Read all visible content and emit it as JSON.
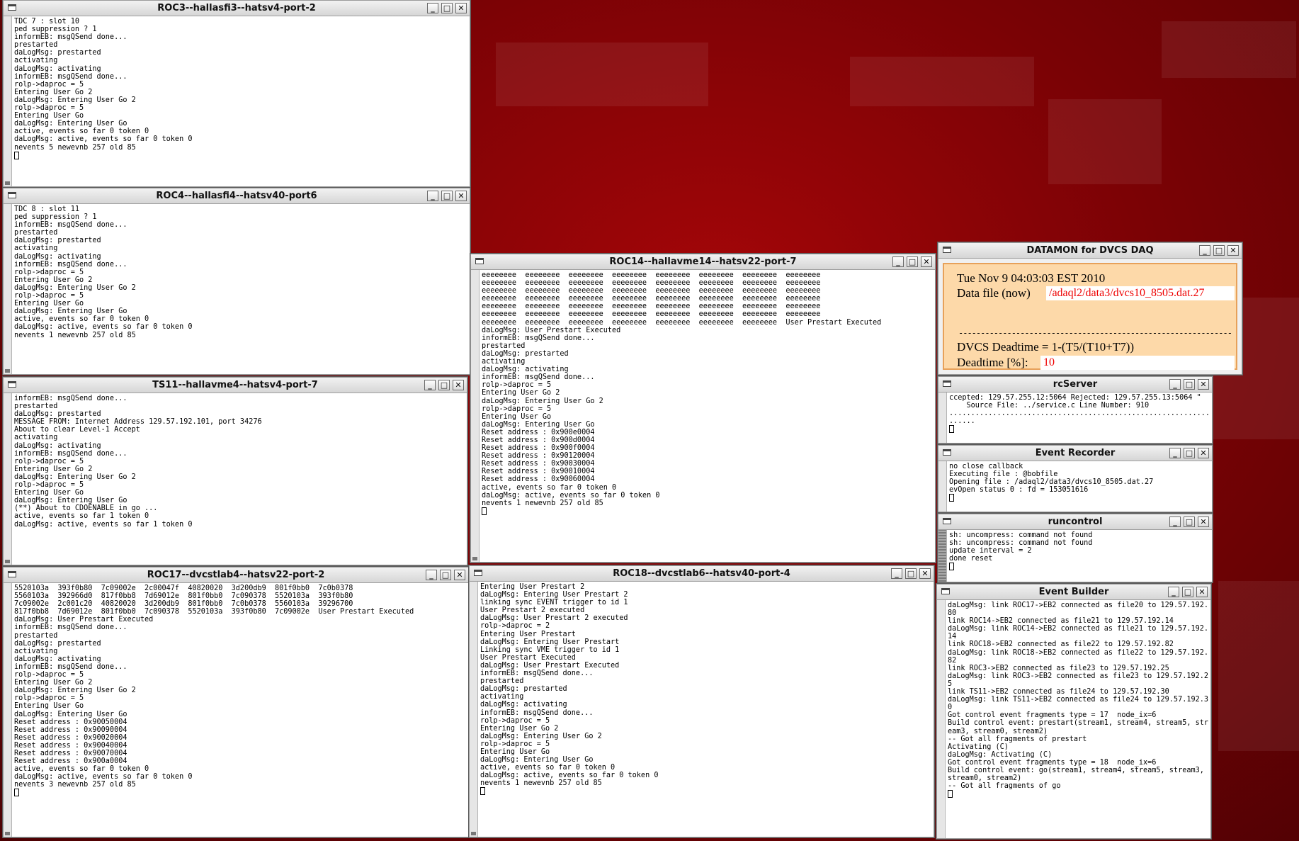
{
  "windows": {
    "roc3": {
      "title": "ROC3--hallasfi3--hatsv4-port-2",
      "log": "TDC 7 : slot 10\nped suppression ? 1\ninformEB: msgQSend done...\nprestarted\ndaLogMsg: prestarted\nactivating\ndaLogMsg: activating\ninformEB: msgQSend done...\nrolp->daproc = 5\nEntering User Go 2\ndaLogMsg: Entering User Go 2\nrolp->daproc = 5\nEntering User Go\ndaLogMsg: Entering User Go\nactive, events so far 0 token 0\ndaLogMsg: active, events so far 0 token 0\nnevents 5 newevnb 257 old 85"
    },
    "roc4": {
      "title": "ROC4--hallasfi4--hatsv40-port6",
      "log": "TDC 8 : slot 11\nped suppression ? 1\ninformEB: msgQSend done...\nprestarted\ndaLogMsg: prestarted\nactivating\ndaLogMsg: activating\ninformEB: msgQSend done...\nrolp->daproc = 5\nEntering User Go 2\ndaLogMsg: Entering User Go 2\nrolp->daproc = 5\nEntering User Go\ndaLogMsg: Entering User Go\nactive, events so far 0 token 0\ndaLogMsg: active, events so far 0 token 0\nnevents 1 newevnb 257 old 85"
    },
    "ts11": {
      "title": "TS11--hallavme4--hatsv4-port-7",
      "log": "informEB: msgQSend done...\nprestarted\ndaLogMsg: prestarted\nMESSAGE FROM: Internet Address 129.57.192.101, port 34276\nAbout to clear Level-1 Accept\nactivating\ndaLogMsg: activating\ninformEB: msgQSend done...\nrolp->daproc = 5\nEntering User Go 2\ndaLogMsg: Entering User Go 2\nrolp->daproc = 5\nEntering User Go\ndaLogMsg: Entering User Go\n(**) About to CDOENABLE in go ...\nactive, events so far 1 token 0\ndaLogMsg: active, events so far 1 token 0"
    },
    "roc17": {
      "title": "ROC17--dvcstlab4--hatsv22-port-2",
      "log": "5520103a  393f0b80  7c09002e  2c00047f  40820020  3d200db9  801f0bb0  7c0b0378\n5560103a  392966d0  817f0bb8  7d69012e  801f0bb0  7c090378  5520103a  393f0b80\n7c09002e  2c001c20  40820020  3d200db9  801f0bb0  7c0b0378  5560103a  39296700\n817f0bb8  7d69012e  801f0bb0  7c090378  5520103a  393f0b80  7c09002e  User Prestart Executed\ndaLogMsg: User Prestart Executed\ninformEB: msgQSend done...\nprestarted\ndaLogMsg: prestarted\nactivating\ndaLogMsg: activating\ninformEB: msgQSend done...\nrolp->daproc = 5\nEntering User Go 2\ndaLogMsg: Entering User Go 2\nrolp->daproc = 5\nEntering User Go\ndaLogMsg: Entering User Go\nReset address : 0x90050004\nReset address : 0x90090004\nReset address : 0x90020004\nReset address : 0x90040004\nReset address : 0x90070004\nReset address : 0x900a0004\nactive, events so far 0 token 0\ndaLogMsg: active, events so far 0 token 0\nnevents 3 newevnb 257 old 85"
    },
    "roc14": {
      "title": "ROC14--hallavme14--hatsv22-port-7",
      "log": "eeeeeeee  eeeeeeee  eeeeeeee  eeeeeeee  eeeeeeee  eeeeeeee  eeeeeeee  eeeeeeee\neeeeeeee  eeeeeeee  eeeeeeee  eeeeeeee  eeeeeeee  eeeeeeee  eeeeeeee  eeeeeeee\neeeeeeee  eeeeeeee  eeeeeeee  eeeeeeee  eeeeeeee  eeeeeeee  eeeeeeee  eeeeeeee\neeeeeeee  eeeeeeee  eeeeeeee  eeeeeeee  eeeeeeee  eeeeeeee  eeeeeeee  eeeeeeee\neeeeeeee  eeeeeeee  eeeeeeee  eeeeeeee  eeeeeeee  eeeeeeee  eeeeeeee  eeeeeeee\neeeeeeee  eeeeeeee  eeeeeeee  eeeeeeee  eeeeeeee  eeeeeeee  eeeeeeee  eeeeeeee\neeeeeeee  eeeeeeee  eeeeeeee  eeeeeeee  eeeeeeee  eeeeeeee  eeeeeeee  User Prestart Executed\ndaLogMsg: User Prestart Executed\ninformEB: msgQSend done...\nprestarted\ndaLogMsg: prestarted\nactivating\ndaLogMsg: activating\ninformEB: msgQSend done...\nrolp->daproc = 5\nEntering User Go 2\ndaLogMsg: Entering User Go 2\nrolp->daproc = 5\nEntering User Go\ndaLogMsg: Entering User Go\nReset address : 0x900e0004\nReset address : 0x900d0004\nReset address : 0x900f0004\nReset address : 0x90120004\nReset address : 0x90030004\nReset address : 0x90010004\nReset address : 0x90060004\nactive, events so far 0 token 0\ndaLogMsg: active, events so far 0 token 0\nnevents 1 newevnb 257 old 85"
    },
    "roc18": {
      "title": "ROC18--dvcstlab6--hatsv40-port-4",
      "log": "Entering User Prestart 2\ndaLogMsg: Entering User Prestart 2\nlinking sync EVENT trigger to id 1\nUser Prestart 2 executed\ndaLogMsg: User Prestart 2 executed\nrolp->daproc = 2\nEntering User Prestart\ndaLogMsg: Entering User Prestart\nLinking sync VME trigger to id 1\nUser Prestart Executed\ndaLogMsg: User Prestart Executed\ninformEB: msgQSend done...\nprestarted\ndaLogMsg: prestarted\nactivating\ndaLogMsg: activating\ninformEB: msgQSend done...\nrolp->daproc = 5\nEntering User Go 2\ndaLogMsg: Entering User Go 2\nrolp->daproc = 5\nEntering User Go\ndaLogMsg: Entering User Go\nactive, events so far 0 token 0\ndaLogMsg: active, events so far 0 token 0\nnevents 1 newevnb 257 old 85"
    },
    "datamon": {
      "title": "DATAMON  for DVCS DAQ",
      "datetime": "Tue Nov  9 04:03:03 EST 2010",
      "datafile_label": "Data file (now)",
      "datafile_value": "/adaql2/data3/dvcs10_8505.dat.27",
      "dashes": "--------------------------------------------------------------------------------",
      "deadtime_formula": "DVCS Deadtime = 1-(T5/(T10+T7))",
      "deadtime_label": "Deadtime [%]:",
      "deadtime_value": "10"
    },
    "rcserver": {
      "title": "rcServer",
      "log": "ccepted: 129.57.255.12:5064 Rejected: 129.57.255.13:5064 \"\n    Source File: ../service.c Line Number: 910\n......................................................................\n......"
    },
    "eventrecorder": {
      "title": "Event Recorder",
      "log": "no close callback\nExecuting file : @bobfile\nOpening file : /adaql2/data3/dvcs10_8505.dat.27\nevOpen status 0 : fd = 153051616"
    },
    "runcontrol": {
      "title": "runcontrol",
      "log": "sh: uncompress: command not found\nsh: uncompress: command not found\nupdate interval = 2\ndone reset"
    },
    "eventbuilder": {
      "title": "Event Builder",
      "log": "daLogMsg: link ROC17->EB2 connected as file20 to 129.57.192.\n80\nlink ROC14->EB2 connected as file21 to 129.57.192.14\ndaLogMsg: link ROC14->EB2 connected as file21 to 129.57.192.\n14\nlink ROC18->EB2 connected as file22 to 129.57.192.82\ndaLogMsg: link ROC18->EB2 connected as file22 to 129.57.192.\n82\nlink ROC3->EB2 connected as file23 to 129.57.192.25\ndaLogMsg: link ROC3->EB2 connected as file23 to 129.57.192.2\n5\nlink TS11->EB2 connected as file24 to 129.57.192.30\ndaLogMsg: link TS11->EB2 connected as file24 to 129.57.192.3\n0\nGot control event fragments type = 17  node_ix=6\nBuild control event: prestart(stream1, stream4, stream5, str\neam3, stream0, stream2)\n-- Got all fragments of prestart\nActivating (C)\ndaLogMsg: Activating (C)\nGot control event fragments type = 18  node_ix=6\nBuild control event: go(stream1, stream4, stream5, stream3,\nstream0, stream2)\n-- Got all fragments of go"
    }
  },
  "buttons": {
    "minimize": "_",
    "maximize": "□",
    "close": "✕"
  },
  "colors": {
    "desktop": "#7a0205",
    "datamon_panel": "#fdd9a9",
    "datamon_value": "#e00000"
  }
}
